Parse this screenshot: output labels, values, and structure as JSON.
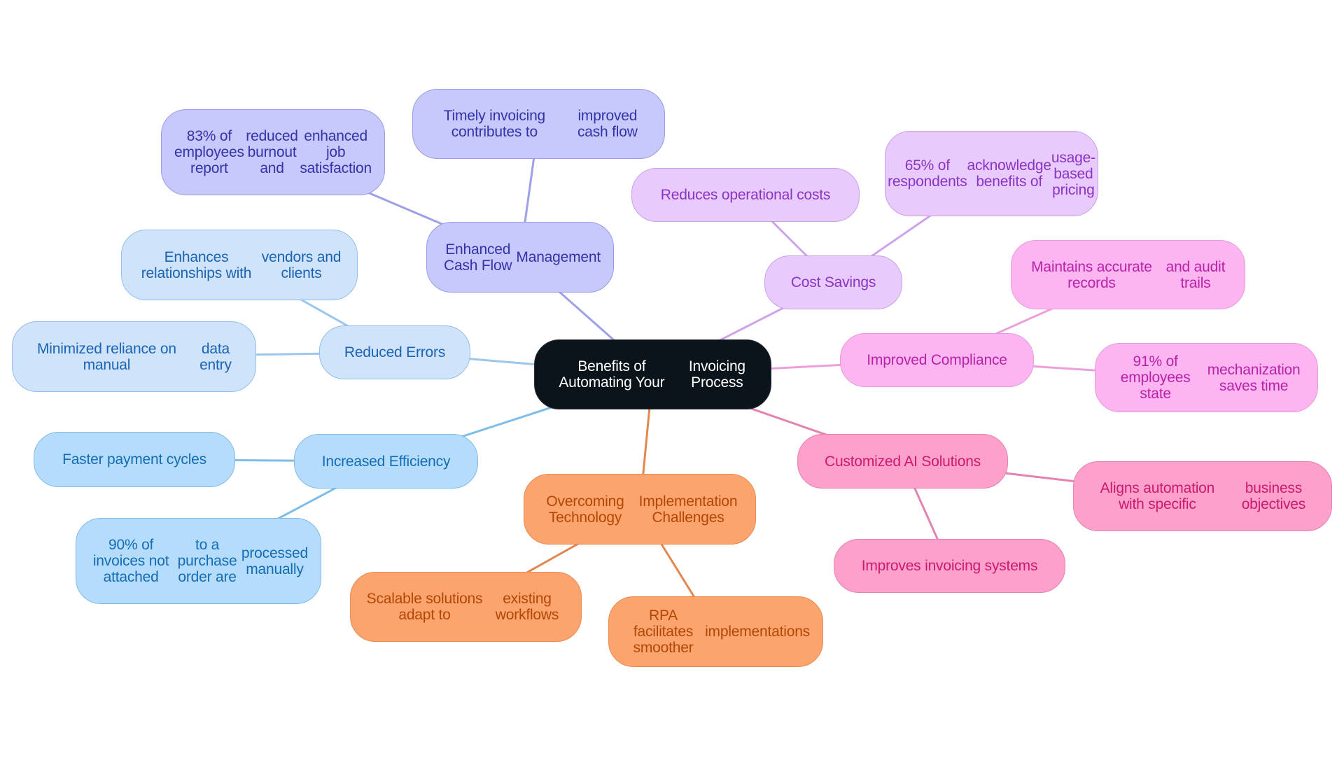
{
  "diagram": {
    "type": "mindmap",
    "colors": {
      "root": "#0b131b",
      "indigo": "#c7c8fc",
      "light_blue": "#cfe3fb",
      "sky_blue": "#b5ddfb",
      "orange": "#fba46e",
      "pink": "#fda0cb",
      "magenta": "#fdb5f2",
      "violet": "#e8cafd",
      "edge_indigo": "#9ea0e8",
      "edge_blue1": "#9cc6ee",
      "edge_blue2": "#7dbde9",
      "edge_orange": "#e2884f",
      "edge_pink": "#e383b1",
      "edge_magenta": "#ec9fdc",
      "edge_violet": "#cfa3ec"
    },
    "root": {
      "label": [
        "Benefits of Automating Your",
        "Invoicing Process"
      ]
    },
    "nodes": {
      "cashflow": {
        "label": [
          "Enhanced Cash Flow",
          "Management"
        ]
      },
      "cashflow_1": {
        "label": [
          "83% of employees report",
          "reduced burnout and",
          "enhanced job satisfaction"
        ]
      },
      "cashflow_2": {
        "label": [
          "Timely invoicing contributes to",
          "improved cash flow"
        ]
      },
      "errors": {
        "label": [
          "Reduced Errors"
        ]
      },
      "errors_1": {
        "label": [
          "Enhances relationships with",
          "vendors and clients"
        ]
      },
      "errors_2": {
        "label": [
          "Minimized reliance on manual",
          "data entry"
        ]
      },
      "efficiency": {
        "label": [
          "Increased Efficiency"
        ]
      },
      "efficiency_1": {
        "label": [
          "Faster payment cycles"
        ]
      },
      "efficiency_2": {
        "label": [
          "90% of invoices not attached",
          "to a purchase order are",
          "processed manually"
        ]
      },
      "tech": {
        "label": [
          "Overcoming Technology",
          "Implementation Challenges"
        ]
      },
      "tech_1": {
        "label": [
          "Scalable solutions adapt to",
          "existing workflows"
        ]
      },
      "tech_2": {
        "label": [
          "RPA facilitates smoother",
          "implementations"
        ]
      },
      "ai": {
        "label": [
          "Customized AI Solutions"
        ]
      },
      "ai_1": {
        "label": [
          "Aligns automation with specific",
          "business objectives"
        ]
      },
      "ai_2": {
        "label": [
          "Improves invoicing systems"
        ]
      },
      "compliance": {
        "label": [
          "Improved Compliance"
        ]
      },
      "compliance_1": {
        "label": [
          "Maintains accurate records",
          "and audit trails"
        ]
      },
      "compliance_2": {
        "label": [
          "91% of employees state",
          "mechanization saves time"
        ]
      },
      "cost": {
        "label": [
          "Cost Savings"
        ]
      },
      "cost_1": {
        "label": [
          "Reduces operational costs"
        ]
      },
      "cost_2": {
        "label": [
          "65% of respondents",
          "acknowledge benefits of",
          "usage-based pricing"
        ]
      }
    }
  }
}
